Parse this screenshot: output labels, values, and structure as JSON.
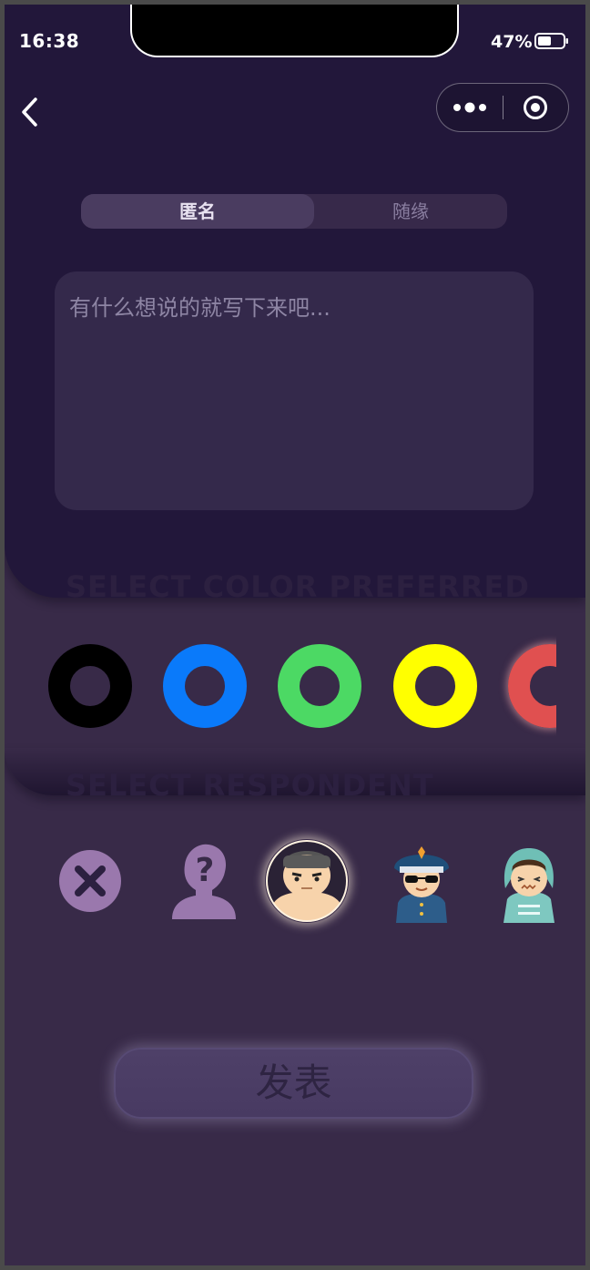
{
  "status_bar": {
    "time": "16:38",
    "battery": "47%",
    "battery_level": 0.47
  },
  "nav": {
    "back_icon": "chevron-left-icon",
    "more_icon": "more-dots-icon",
    "close_icon": "target-icon"
  },
  "mode_tabs": [
    {
      "label": "匿名",
      "active": true
    },
    {
      "label": "随缘",
      "active": false
    }
  ],
  "compose": {
    "placeholder": "有什么想说的就写下来吧..."
  },
  "color_section": {
    "title": "SELECT COLOR PREFERRED",
    "colors": [
      "#000000",
      "#0a7afa",
      "#4cd964",
      "#ffff00",
      "#e05050"
    ]
  },
  "respondent_section": {
    "title": "SELECT RESPONDENT",
    "options": [
      "none",
      "unknown",
      "muscle-man",
      "police",
      "nurse"
    ],
    "selected": "muscle-man"
  },
  "publish_button": {
    "label": "发表"
  },
  "colors": {
    "background": "#382a48",
    "panel": "#22173a",
    "accent": "#4a3c60"
  }
}
